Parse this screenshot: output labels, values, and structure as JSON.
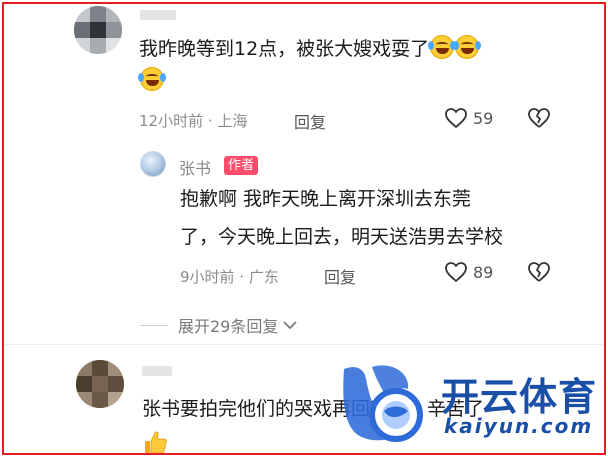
{
  "comment1": {
    "text_line1": "我昨晚等到12点，被张大嫂戏耍了",
    "meta": "12小时前 · 上海",
    "reply_label": "回复",
    "likes": "59",
    "emojis": [
      "crying-laughing-face",
      "crying-laughing-face",
      "crying-laughing-face"
    ]
  },
  "reply1": {
    "author": "张书",
    "badge": "作者",
    "text_line1": "抱歉啊 我昨天晚上离开深圳去东莞",
    "text_line2": "了，今天晚上回去，明天送浩男去学校",
    "meta": "9小时前 · 广东",
    "reply_label": "回复",
    "likes": "89"
  },
  "expand": {
    "label": "展开29条回复"
  },
  "comment2": {
    "text": "张书要拍完他们的哭戏再回家吧，辛苦了",
    "emoji": "thumbs-up"
  },
  "watermark": {
    "brand": "开云体育",
    "url": "kaiyun.com",
    "color": "#1a4fa8"
  }
}
